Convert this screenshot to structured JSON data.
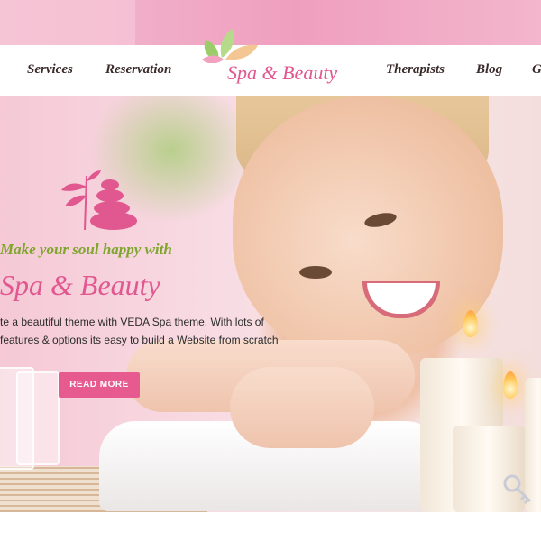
{
  "nav": {
    "left": [
      "Services",
      "Reservation"
    ],
    "right": [
      "Therapists",
      "Blog",
      "G"
    ],
    "logo_text": "Spa & Beauty"
  },
  "hero": {
    "tagline": "Make your soul happy with",
    "brand": "Spa & Beauty",
    "description": "te a beautiful theme with VEDA Spa theme. With lots of features & options its easy to build a Website from scratch",
    "button_label": "READ MORE"
  },
  "colors": {
    "accent_pink": "#e75a8f",
    "tagline_green": "#7ea52c",
    "nav_text": "#3a2a2a"
  },
  "icons": [
    "leaf-logo-icon",
    "spa-stones-icon",
    "key-icon"
  ]
}
